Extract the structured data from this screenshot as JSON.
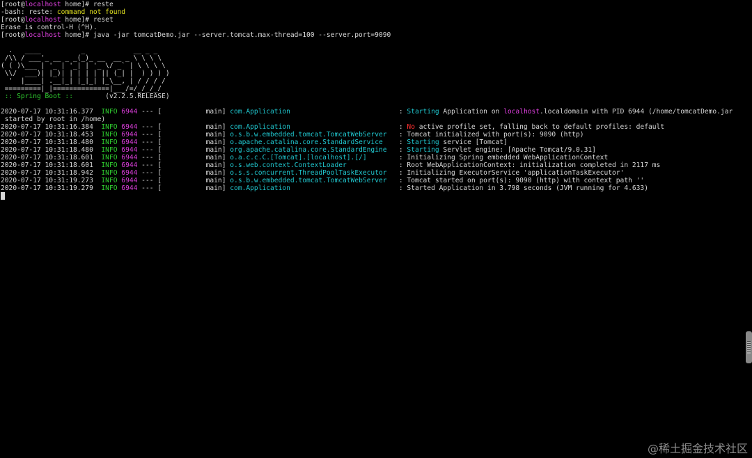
{
  "terminal": {
    "lines": [
      [
        {
          "t": "[root@",
          "c": "white"
        },
        {
          "t": "localhost",
          "c": "magenta"
        },
        {
          "t": " home]# reste",
          "c": "white"
        }
      ],
      [
        {
          "t": "-bash: reste: ",
          "c": "white"
        },
        {
          "t": "command not found",
          "c": "yellow"
        }
      ],
      [
        {
          "t": "[root@",
          "c": "white"
        },
        {
          "t": "localhost",
          "c": "magenta"
        },
        {
          "t": " home]# reset",
          "c": "white"
        }
      ],
      [
        {
          "t": "Erase is control-H (^H).",
          "c": "white"
        }
      ],
      [
        {
          "t": "[root@",
          "c": "white"
        },
        {
          "t": "localhost",
          "c": "magenta"
        },
        {
          "t": " home]# java -jar tomcatDemo.jar --server.tomcat.max-thread=100 --server.port=9090",
          "c": "white"
        }
      ],
      [],
      [
        {
          "t": "  .   ____          _            __ _ _",
          "c": "white"
        }
      ],
      [
        {
          "t": " /\\\\ / ___'_ __ _ _(_)_ __  __ _ \\ \\ \\ \\",
          "c": "white"
        }
      ],
      [
        {
          "t": "( ( )\\___ | '_ | '_| | '_ \\/ _` | \\ \\ \\ \\",
          "c": "white"
        }
      ],
      [
        {
          "t": " \\\\/  ___)| |_)| | | | | || (_| |  ) ) ) )",
          "c": "white"
        }
      ],
      [
        {
          "t": "  '  |____| .__|_| |_|_| |_\\__, | / / / /",
          "c": "white"
        }
      ],
      [
        {
          "t": " =========|_|==============|___/=/_/_/_/",
          "c": "white"
        }
      ],
      [
        {
          "t": " :: Spring Boot ::        ",
          "c": "green"
        },
        {
          "t": "(v2.2.5.RELEASE)",
          "c": "white"
        }
      ],
      [],
      [
        {
          "t": "2020-07-17 10:31:16.377  ",
          "c": "white"
        },
        {
          "t": "INFO",
          "c": "green"
        },
        {
          "t": " ",
          "c": "white"
        },
        {
          "t": "6944",
          "c": "magenta"
        },
        {
          "t": " --- [           main] ",
          "c": "white"
        },
        {
          "t": "com.Application                          ",
          "c": "cyan"
        },
        {
          "t": " : ",
          "c": "white"
        },
        {
          "t": "Starting",
          "c": "cyan"
        },
        {
          "t": " Application on ",
          "c": "white"
        },
        {
          "t": "localhost",
          "c": "magenta"
        },
        {
          "t": ".localdomain with PID 6944 (/home/tomcatDemo.jar",
          "c": "white"
        }
      ],
      [
        {
          "t": " started by root in /home)",
          "c": "white"
        }
      ],
      [
        {
          "t": "2020-07-17 10:31:16.384  ",
          "c": "white"
        },
        {
          "t": "INFO",
          "c": "green"
        },
        {
          "t": " ",
          "c": "white"
        },
        {
          "t": "6944",
          "c": "magenta"
        },
        {
          "t": " --- [           main] ",
          "c": "white"
        },
        {
          "t": "com.Application                          ",
          "c": "cyan"
        },
        {
          "t": " : ",
          "c": "white"
        },
        {
          "t": "No",
          "c": "red"
        },
        {
          "t": " active profile set, falling back to default profiles: default",
          "c": "white"
        }
      ],
      [
        {
          "t": "2020-07-17 10:31:18.453  ",
          "c": "white"
        },
        {
          "t": "INFO",
          "c": "green"
        },
        {
          "t": " ",
          "c": "white"
        },
        {
          "t": "6944",
          "c": "magenta"
        },
        {
          "t": " --- [           main] ",
          "c": "white"
        },
        {
          "t": "o.s.b.w.embedded.tomcat.TomcatWebServer  ",
          "c": "cyan"
        },
        {
          "t": " : Tomcat initialized with port(s): 9090 (http)",
          "c": "white"
        }
      ],
      [
        {
          "t": "2020-07-17 10:31:18.480  ",
          "c": "white"
        },
        {
          "t": "INFO",
          "c": "green"
        },
        {
          "t": " ",
          "c": "white"
        },
        {
          "t": "6944",
          "c": "magenta"
        },
        {
          "t": " --- [           main] ",
          "c": "white"
        },
        {
          "t": "o.apache.catalina.core.StandardService   ",
          "c": "cyan"
        },
        {
          "t": " : ",
          "c": "white"
        },
        {
          "t": "Starting",
          "c": "cyan"
        },
        {
          "t": " service [Tomcat]",
          "c": "white"
        }
      ],
      [
        {
          "t": "2020-07-17 10:31:18.480  ",
          "c": "white"
        },
        {
          "t": "INFO",
          "c": "green"
        },
        {
          "t": " ",
          "c": "white"
        },
        {
          "t": "6944",
          "c": "magenta"
        },
        {
          "t": " --- [           main] ",
          "c": "white"
        },
        {
          "t": "org.apache.catalina.core.StandardEngine  ",
          "c": "cyan"
        },
        {
          "t": " : ",
          "c": "white"
        },
        {
          "t": "Starting",
          "c": "cyan"
        },
        {
          "t": " Servlet engine: [Apache Tomcat/9.0.31]",
          "c": "white"
        }
      ],
      [
        {
          "t": "2020-07-17 10:31:18.601  ",
          "c": "white"
        },
        {
          "t": "INFO",
          "c": "green"
        },
        {
          "t": " ",
          "c": "white"
        },
        {
          "t": "6944",
          "c": "magenta"
        },
        {
          "t": " --- [           main] ",
          "c": "white"
        },
        {
          "t": "o.a.c.c.C.[Tomcat].[localhost].[/]       ",
          "c": "cyan"
        },
        {
          "t": " : Initializing Spring embedded WebApplicationContext",
          "c": "white"
        }
      ],
      [
        {
          "t": "2020-07-17 10:31:18.601  ",
          "c": "white"
        },
        {
          "t": "INFO",
          "c": "green"
        },
        {
          "t": " ",
          "c": "white"
        },
        {
          "t": "6944",
          "c": "magenta"
        },
        {
          "t": " --- [           main] ",
          "c": "white"
        },
        {
          "t": "o.s.web.context.ContextLoader            ",
          "c": "cyan"
        },
        {
          "t": " : Root WebApplicationContext: initialization completed in 2117 ms",
          "c": "white"
        }
      ],
      [
        {
          "t": "2020-07-17 10:31:18.942  ",
          "c": "white"
        },
        {
          "t": "INFO",
          "c": "green"
        },
        {
          "t": " ",
          "c": "white"
        },
        {
          "t": "6944",
          "c": "magenta"
        },
        {
          "t": " --- [           main] ",
          "c": "white"
        },
        {
          "t": "o.s.s.concurrent.ThreadPoolTaskExecutor  ",
          "c": "cyan"
        },
        {
          "t": " : Initializing ExecutorService 'applicationTaskExecutor'",
          "c": "white"
        }
      ],
      [
        {
          "t": "2020-07-17 10:31:19.273  ",
          "c": "white"
        },
        {
          "t": "INFO",
          "c": "green"
        },
        {
          "t": " ",
          "c": "white"
        },
        {
          "t": "6944",
          "c": "magenta"
        },
        {
          "t": " --- [           main] ",
          "c": "white"
        },
        {
          "t": "o.s.b.w.embedded.tomcat.TomcatWebServer  ",
          "c": "cyan"
        },
        {
          "t": " : Tomcat started on port(s): 9090 (http) with context path ''",
          "c": "white"
        }
      ],
      [
        {
          "t": "2020-07-17 10:31:19.279  ",
          "c": "white"
        },
        {
          "t": "INFO",
          "c": "green"
        },
        {
          "t": " ",
          "c": "white"
        },
        {
          "t": "6944",
          "c": "magenta"
        },
        {
          "t": " --- [           main] ",
          "c": "white"
        },
        {
          "t": "com.Application                          ",
          "c": "cyan"
        },
        {
          "t": " : Started Application in 3.798 seconds (JVM running for 4.633)",
          "c": "white"
        }
      ]
    ]
  },
  "watermark": "@稀土掘金技术社区",
  "colors": {
    "background": "#000000",
    "text": "#d8d8d8",
    "magenta": "#e040e0",
    "yellow": "#e0e020",
    "green": "#30d030",
    "cyan": "#20c8d0",
    "red": "#ff3030"
  }
}
